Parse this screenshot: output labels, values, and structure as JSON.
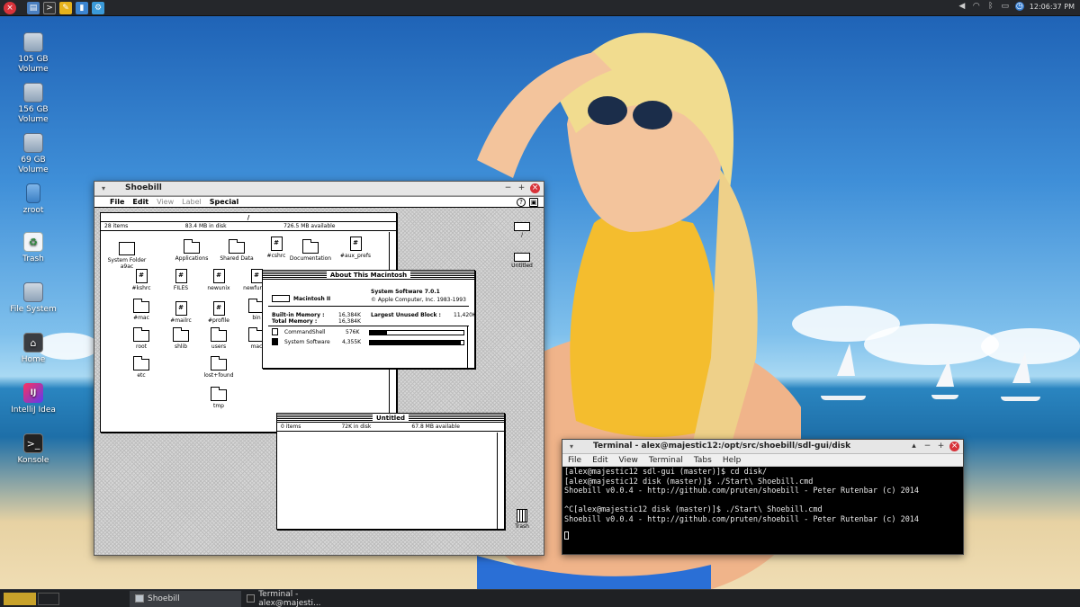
{
  "top_panel": {
    "launchers": [
      {
        "icon": "power-icon",
        "color": "#d8333a"
      },
      {
        "icon": "save-icon",
        "color": "#4a7fc0"
      },
      {
        "icon": "terminal-icon",
        "color": "#333"
      },
      {
        "icon": "notes-icon",
        "color": "#e6b21c"
      },
      {
        "icon": "editor-icon",
        "color": "#3b84d0"
      },
      {
        "icon": "settings-icon",
        "color": "#3a9ad9"
      }
    ],
    "clock": "12:06:37 PM"
  },
  "desktop_icons": [
    {
      "label": "105 GB Volume",
      "icon": "drive-icon"
    },
    {
      "label": "156 GB Volume",
      "icon": "drive-icon"
    },
    {
      "label": "69 GB Volume",
      "icon": "drive-icon"
    },
    {
      "label": "zroot",
      "icon": "drive-icon"
    },
    {
      "label": "Trash",
      "icon": "trash-icon"
    },
    {
      "label": "File System",
      "icon": "drive-icon"
    },
    {
      "label": "Home",
      "icon": "home-icon"
    },
    {
      "label": "IntelliJ Idea",
      "icon": "intellij-icon"
    },
    {
      "label": "Konsole",
      "icon": "terminal-icon"
    }
  ],
  "shoebill": {
    "title": "Shoebill",
    "menu": {
      "file": "File",
      "edit": "Edit",
      "view": "View",
      "label": "Label",
      "special": "Special"
    },
    "root_window": {
      "title": "/",
      "items_count": "28 items",
      "in_disk": "83.4 MB in disk",
      "available": "726.5 MB available",
      "items": [
        {
          "label": "System Folder a9ac",
          "type": "sysfolder"
        },
        {
          "label": "Applications",
          "type": "folder"
        },
        {
          "label": "Shared Data",
          "type": "folder"
        },
        {
          "label": "#cshrc",
          "type": "doc"
        },
        {
          "label": "Documentation",
          "type": "folder"
        },
        {
          "label": "#aux_prefs",
          "type": "doc"
        },
        {
          "label": "#kshrc",
          "type": "doc"
        },
        {
          "label": "FILES",
          "type": "doc"
        },
        {
          "label": "newunix",
          "type": "doc"
        },
        {
          "label": "newfuntix",
          "type": "doc"
        },
        {
          "label": "#mac",
          "type": "folder"
        },
        {
          "label": "#mailrc",
          "type": "doc"
        },
        {
          "label": "#profile",
          "type": "doc"
        },
        {
          "label": "bin",
          "type": "folder"
        },
        {
          "label": "root",
          "type": "folder"
        },
        {
          "label": "shlib",
          "type": "folder"
        },
        {
          "label": "users",
          "type": "folder"
        },
        {
          "label": "mac",
          "type": "folder"
        },
        {
          "label": "etc",
          "type": "folder"
        },
        {
          "label": "lost+found",
          "type": "folder"
        },
        {
          "label": "tmp",
          "type": "folder"
        }
      ]
    },
    "about": {
      "title": "About This Macintosh",
      "machine": "Macintosh II",
      "system_software": "System Software 7.0.1",
      "copyright": "© Apple Computer, Inc. 1983-1993",
      "built_in_label": "Built-in Memory :",
      "built_in_value": "16,384K",
      "total_label": "Total Memory :",
      "total_value": "16,384K",
      "largest_label": "Largest Unused Block :",
      "largest_value": "11,420K",
      "apps": [
        {
          "name": "CommandShell",
          "size": "576K",
          "fraction": 0.18
        },
        {
          "name": "System Software",
          "size": "4,355K",
          "fraction": 0.97
        }
      ]
    },
    "untitled_window": {
      "title": "Untitled",
      "items_count": "0 items",
      "in_disk": "72K in disk",
      "available": "67.8 MB available"
    },
    "mac_desktop_icons": [
      {
        "label": "/",
        "icon": "mac-disk-icon"
      },
      {
        "label": "Untitled",
        "icon": "mac-disk-icon"
      },
      {
        "label": "Trash",
        "icon": "mac-trash-icon"
      }
    ]
  },
  "terminal": {
    "title": "Terminal - alex@majestic12:/opt/src/shoebill/sdl-gui/disk",
    "menu": [
      "File",
      "Edit",
      "View",
      "Terminal",
      "Tabs",
      "Help"
    ],
    "lines": [
      "[alex@majestic12 sdl-gui (master)]$ cd disk/",
      "[alex@majestic12 disk (master)]$ ./Start\\ Shoebill.cmd",
      "Shoebill v0.0.4 - http://github.com/pruten/shoebill - Peter Rutenbar (c) 2014",
      "",
      "^C[alex@majestic12 disk (master)]$ ./Start\\ Shoebill.cmd",
      "Shoebill v0.0.4 - http://github.com/pruten/shoebill - Peter Rutenbar (c) 2014",
      ""
    ]
  },
  "taskbar": {
    "tasks": [
      {
        "label": "Shoebill",
        "active": true
      },
      {
        "label": "Terminal - alex@majesti...",
        "active": false
      }
    ]
  }
}
